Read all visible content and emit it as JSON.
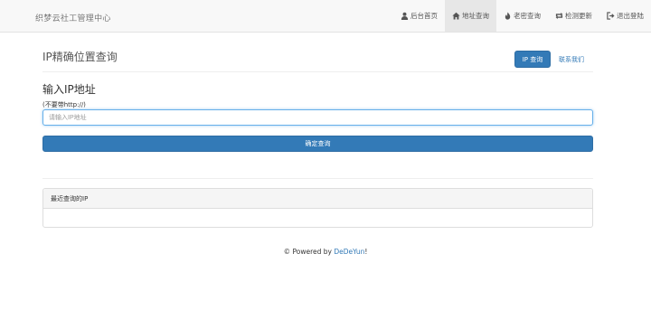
{
  "navbar": {
    "brand": "织梦云社工管理中心",
    "items": [
      {
        "label": "后台首页",
        "icon": "user-icon",
        "active": false
      },
      {
        "label": "地址查询",
        "icon": "home-icon",
        "active": true
      },
      {
        "label": "老密查询",
        "icon": "fire-icon",
        "active": false
      },
      {
        "label": "检测更新",
        "icon": "retweet-icon",
        "active": false
      },
      {
        "label": "退出登陆",
        "icon": "log-out-icon",
        "active": false
      }
    ]
  },
  "header": {
    "title": "IP精确位置查询",
    "ip_button": "IP 查询",
    "contact_link": "联系我们"
  },
  "form": {
    "heading": "输入IP地址",
    "hint": "(不要带http://)",
    "placeholder": "请输入IP地址",
    "submit": "确定查询"
  },
  "recent": {
    "heading": "最近查询的IP"
  },
  "footer": {
    "prefix": "© Powered by ",
    "link": "DeDeYun",
    "suffix": "!"
  },
  "colors": {
    "primary": "#337ab7",
    "navbar_bg": "#f8f8f8",
    "nav_active_bg": "#e7e7e7",
    "input_focus": "#66afe9"
  }
}
